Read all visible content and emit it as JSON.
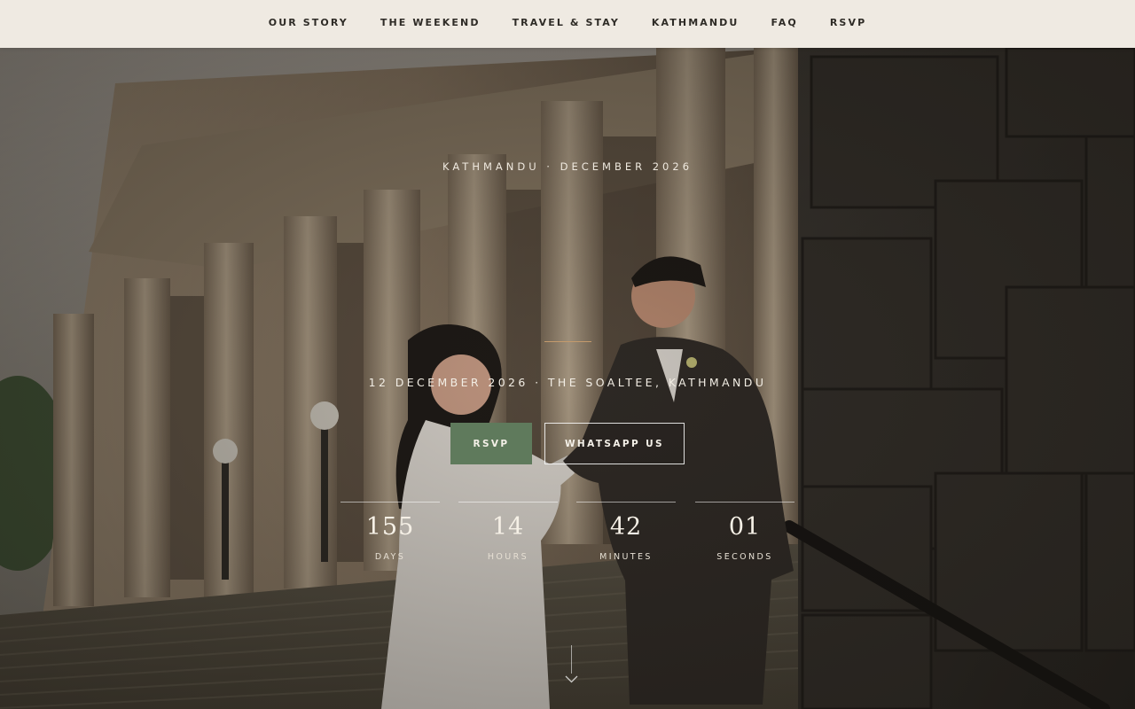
{
  "nav": {
    "items": [
      {
        "label": "OUR STORY"
      },
      {
        "label": "THE WEEKEND"
      },
      {
        "label": "TRAVEL & STAY"
      },
      {
        "label": "KATHMANDU"
      },
      {
        "label": "FAQ"
      },
      {
        "label": "RSVP"
      }
    ]
  },
  "hero": {
    "eyebrow": "KATHMANDU · DECEMBER 2026",
    "details": "12 DECEMBER 2026 · THE SOALTEE, KATHMANDU",
    "buttons": {
      "rsvp": "RSVP",
      "whatsapp": "WHATSAPP US"
    },
    "countdown": [
      {
        "value": "155",
        "label": "DAYS"
      },
      {
        "value": "14",
        "label": "HOURS"
      },
      {
        "value": "42",
        "label": "MINUTES"
      },
      {
        "value": "01",
        "label": "SECONDS"
      }
    ]
  },
  "colors": {
    "nav_bg": "#efeae2",
    "accent_green": "#5f7a5c",
    "divider_gold": "#c49a6c"
  },
  "icons": {
    "scroll": "chevron-down-icon"
  }
}
